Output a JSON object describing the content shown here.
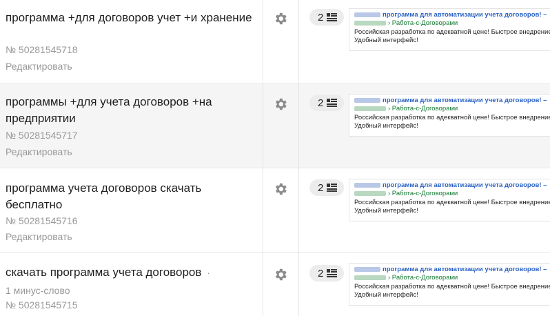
{
  "rows": [
    {
      "phrase": "программа +для договоров учет +и хранение",
      "minus": "",
      "id": "№ 50281545718",
      "edit": "Редактировать",
      "ads_count": "2",
      "ad": {
        "title": "программа для автоматизации учета договоров! –",
        "url": "› Работа-с-Договорами",
        "text": "Российская разработка по адекватной цене! Быстрое внедрение! Удобный интерфейс!"
      }
    },
    {
      "phrase": "программы +для учета договоров +на предприятии",
      "minus": "",
      "id": "№ 50281545717",
      "edit": "Редактировать",
      "ads_count": "2",
      "ad": {
        "title": "программа для автоматизации учета договоров! –",
        "url": "› Работа-с-Договорами",
        "text": "Российская разработка по адекватной цене! Быстрое внедрение! Удобный интерфейс!"
      }
    },
    {
      "phrase": "программа учета договоров скачать бесплатно",
      "minus": "",
      "id": "№ 50281545716",
      "edit": "Редактировать",
      "ads_count": "2",
      "ad": {
        "title": "программа для автоматизации учета договоров! –",
        "url": "› Работа-с-Договорами",
        "text": "Российская разработка по адекватной цене! Быстрое внедрение! Удобный интерфейс!"
      }
    },
    {
      "phrase": "скачать программа учета договоров",
      "phrase_dot": "·",
      "minus": "1 минус-слово",
      "id": "№ 50281545715",
      "edit": "",
      "ads_count": "2",
      "ad": {
        "title": "программа для автоматизации учета договоров! –",
        "url": "› Работа-с-Договорами",
        "text": "Российская разработка по адекватной цене! Быстрое внедрение! Удобный интерфейс!"
      }
    }
  ]
}
